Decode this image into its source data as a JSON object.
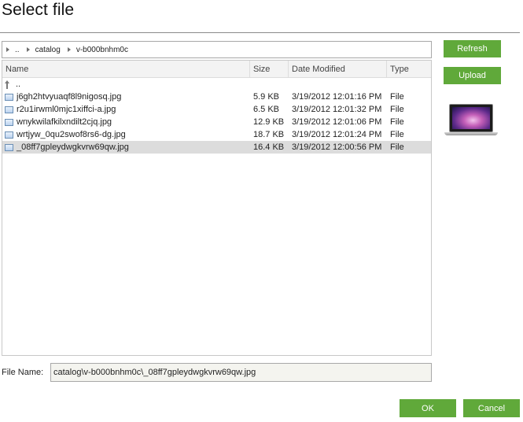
{
  "dialog": {
    "title": "Select file"
  },
  "breadcrumb": {
    "items": [
      "..",
      "catalog",
      "v-b000bnhm0c"
    ]
  },
  "file_list": {
    "columns": {
      "name": "Name",
      "size": "Size",
      "date": "Date Modified",
      "type": "Type"
    },
    "up_label": "..",
    "rows": [
      {
        "name": "j6gh2htvyuaqf8l9nigosq.jpg",
        "size": "5.9 KB",
        "date": "3/19/2012 12:01:16 PM",
        "type": "File"
      },
      {
        "name": "r2u1irwml0mjc1xiffci-a.jpg",
        "size": "6.5 KB",
        "date": "3/19/2012 12:01:32 PM",
        "type": "File"
      },
      {
        "name": "wnykwilafkilxndilt2cjq.jpg",
        "size": "12.9 KB",
        "date": "3/19/2012 12:01:06 PM",
        "type": "File"
      },
      {
        "name": "wrtjyw_0qu2swof8rs6-dg.jpg",
        "size": "18.7 KB",
        "date": "3/19/2012 12:01:24 PM",
        "type": "File"
      },
      {
        "name": "_08ff7gpleydwgkvrw69qw.jpg",
        "size": "16.4 KB",
        "date": "3/19/2012 12:00:56 PM",
        "type": "File",
        "selected": true
      }
    ]
  },
  "side_panel": {
    "refresh_label": "Refresh",
    "upload_label": "Upload",
    "preview_icon": "laptop-preview"
  },
  "footer": {
    "file_name_label": "File Name:",
    "file_name_value": "catalog\\v-b000bnhm0c\\_08ff7gpleydwgkvrw69qw.jpg",
    "ok_label": "OK",
    "cancel_label": "Cancel"
  },
  "colors": {
    "accent": "#60a93a",
    "selected_row": "#dcdcdc"
  }
}
